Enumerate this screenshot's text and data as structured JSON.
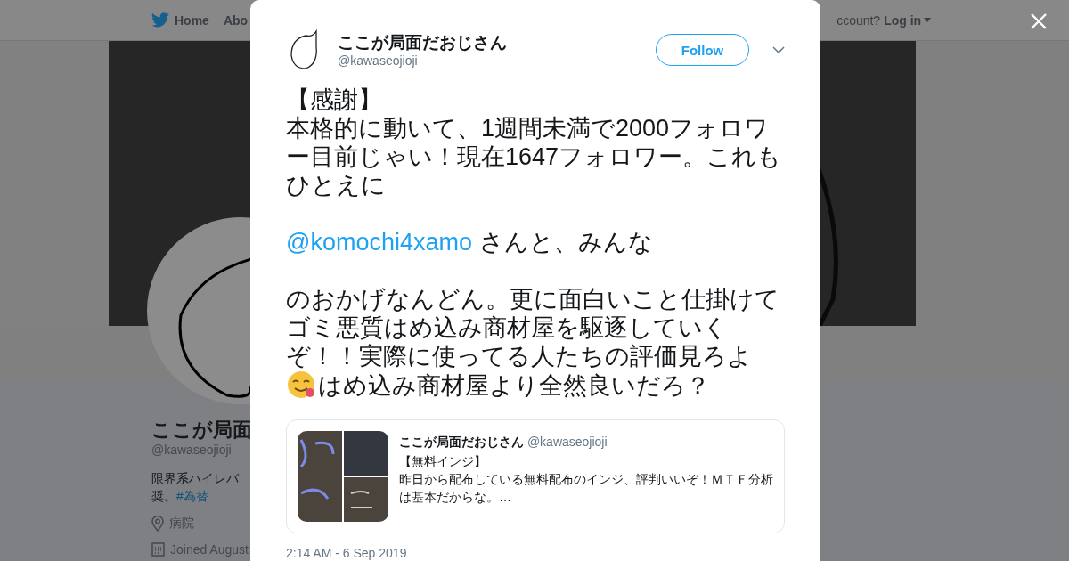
{
  "nav": {
    "home": "Home",
    "about": "Abo",
    "account_prompt": "ccount?",
    "login": "Log in"
  },
  "profile": {
    "name": "ここが局面",
    "handle": "@kawaseojioji",
    "bio": "限界系ハイレバ",
    "bio_end": "奨。",
    "hashtag": "#為替",
    "location": "病院",
    "joined": "Joined August"
  },
  "tweet": {
    "author": "ここが局面だおじさん",
    "handle": "@kawaseojioji",
    "follow": "Follow",
    "paragraphs": [
      [
        {
          "kind": "text",
          "text": "【感謝】"
        },
        {
          "kind": "break"
        },
        {
          "kind": "text",
          "text": "本格的に動いて、1週間未満で2000フォロワー目前じゃい！現在1647フォロワー。これもひとえに"
        }
      ],
      [
        {
          "kind": "mention",
          "text": "@komochi4xamo"
        },
        {
          "kind": "text",
          "text": " さんと、みんな"
        }
      ],
      [
        {
          "kind": "text",
          "text": "のおかげなんどん。更に面白いこと仕掛けてゴミ悪質はめ込み商材屋を駆逐していくぞ！！実際に使ってる人たちの評価見ろよ"
        },
        {
          "kind": "break"
        },
        {
          "kind": "emoji"
        },
        {
          "kind": "text",
          "text": "はめ込み商材屋より全然良いだろ？"
        }
      ]
    ],
    "quote": {
      "author": "ここが局面だおじさん",
      "handle": "@kawaseojioji",
      "title": "【無料インジ】",
      "text": "昨日から配布している無料配布のインジ、評判いいぞ！ＭＴＦ分析は基本だからな。…"
    },
    "timestamp": "2:14 AM - 6 Sep 2019"
  }
}
